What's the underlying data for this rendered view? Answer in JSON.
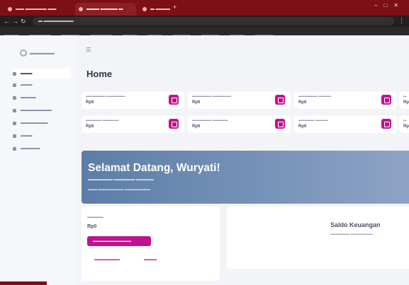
{
  "browser": {
    "tabs": [
      {
        "label": "▬▬ ▬▬▬▬▬ ▬▬"
      },
      {
        "label": "▬▬▬ ▬▬▬▬ ▬"
      },
      {
        "label": "▬ ▬▬▬▬▬"
      }
    ],
    "new_tab": "+",
    "address": "▬ ▬▬▬▬▬▬▬",
    "bookmarks": [
      "▬▬▬▬",
      "▬▬▬▬▬▬",
      "▬▬▬▬▬",
      "▬▬▬▬▬▬",
      "▬▬▬▬",
      "▬▬▬▬",
      "▬▬▬▬▬",
      "▬▬▬▬▬",
      "▬▬▬▬",
      "▬▬▬▬▬"
    ]
  },
  "sidebar": {
    "logo": "▬▬▬▬▬",
    "items": [
      {
        "label": "▬▬▬"
      },
      {
        "label": "▬▬▬"
      },
      {
        "label": "▬▬▬▬"
      },
      {
        "label": "▬▬▬▬▬▬▬▬"
      },
      {
        "label": "▬▬▬▬▬▬▬"
      },
      {
        "label": "▬▬▬"
      },
      {
        "label": "▬▬▬▬▬"
      }
    ]
  },
  "main": {
    "title": "Home",
    "cards": [
      {
        "label": "▬▬▬▬▬▬ ▬▬▬▬▬▬",
        "value": "Rp0"
      },
      {
        "label": "▬▬▬▬▬▬ ▬▬▬▬▬▬",
        "value": "Rp0"
      },
      {
        "label": "▬▬▬▬▬▬ ▬▬▬▬",
        "value": "Rp0"
      },
      {
        "label": "▬",
        "value": "Rp"
      },
      {
        "label": "▬▬▬▬▬ ▬▬▬▬▬",
        "value": "Rp0"
      },
      {
        "label": "▬▬▬▬▬▬ ▬▬▬▬▬",
        "value": "Rp0"
      },
      {
        "label": "▬▬▬▬▬ ▬▬▬▬",
        "value": "Rp0"
      },
      {
        "label": "▬",
        "value": "Rp"
      }
    ],
    "banner": {
      "title": "Selamat Datang, Wuryati!",
      "subtitle": "▬▬▬▬▬▬▬ ▬▬▬▬▬▬ ▬▬▬▬▬",
      "meta": "▬▬▬ ▬▬▬▬▬▬▬▬ ▬▬▬▬▬▬▬▬"
    },
    "saldo_card": {
      "label": "▬▬▬▬▬",
      "value": "Rp0",
      "button": "▬▬▬▬▬▬▬▬▬▬▬▬",
      "link_1": "▬▬▬▬▬▬▬▬",
      "link_2": "▬▬▬▬"
    },
    "info_card": {
      "title": "Saldo Keuangan",
      "subtitle": "▬▬▬▬▬▬ ▬▬▬▬▬▬▬"
    }
  },
  "colors": {
    "browser_frame": "#7d0f17",
    "accent": "#c0128e",
    "banner_start": "#5c7da8",
    "banner_end": "#8ea4c6"
  }
}
